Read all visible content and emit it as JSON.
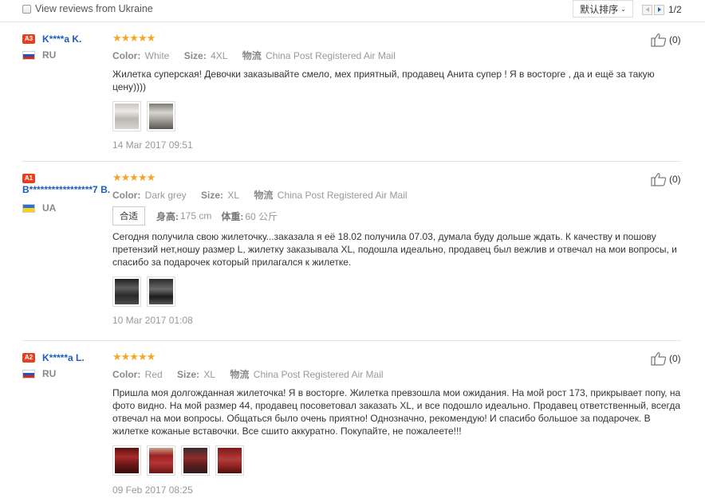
{
  "topbar": {
    "filter_label": "View reviews from Ukraine",
    "sort_label": "默认排序",
    "page_indicator": "1/2"
  },
  "reviews": [
    {
      "level": "A3",
      "name": "K****a K.",
      "country": "RU",
      "rating": 5,
      "stars_text": "★★★★★",
      "color_label": "Color:",
      "color_value": "White",
      "size_label": "Size:",
      "size_value": "4XL",
      "logistics_label": "物流",
      "logistics_value": "China Post Registered Air Mail",
      "text": "Жилетка суперская! Девочки заказывайте смело, мех приятный, продавец Анита супер ! Я в восторге , да и ещё за такую цену))))",
      "likes": "(0)",
      "date": "14 Mar 2017 09:51"
    },
    {
      "level": "A1",
      "name": "B*****************7 B.",
      "country": "UA",
      "rating": 5,
      "stars_text": "★★★★★",
      "color_label": "Color:",
      "color_value": "Dark grey",
      "size_label": "Size:",
      "size_value": "XL",
      "logistics_label": "物流",
      "logistics_value": "China Post Registered Air Mail",
      "fit_tag": "合适",
      "height_label": "身高:",
      "height_value": "175 cm",
      "weight_label": "体重:",
      "weight_value": "60 公斤",
      "text": "Сегодня получила свою жилеточку...заказала я её 18.02 получила 07.03, думала буду дольше ждать. К качеству и пошову претензий нет,ношу размер L, жилетку заказывала XL, подошла идеально, продавец был вежлив и отвечал на мои вопросы, и спасибо за подарочек который прилагался к жилетке.",
      "likes": "(0)",
      "date": "10 Mar 2017 01:08"
    },
    {
      "level": "A2",
      "name": "K*****a L.",
      "country": "RU",
      "rating": 5,
      "stars_text": "★★★★★",
      "color_label": "Color:",
      "color_value": "Red",
      "size_label": "Size:",
      "size_value": "XL",
      "logistics_label": "物流",
      "logistics_value": "China Post Registered Air Mail",
      "text": "Пришла моя долгожданная жилеточка! Я в восторге. Жилетка превзошла мои ожидания. На мой рост 173, прикрывает попу, на фото видно. На мой размер 44, продавец посоветовал заказать XL, и все подошло идеально. Продавец ответственный, всегда отвечал на мои вопросы. Общаться было очень приятно! Однозначно, рекомендую! И спасибо большое за подарочек. В жилетке кожаные вставочки. Все сшито аккуратно. Покупайте, не пожалеете!!!",
      "likes": "(0)",
      "date": "09 Feb 2017 08:25"
    }
  ],
  "colors": {
    "star": "#f5a623",
    "username": "#1d5db7",
    "level_badge": "#e64021"
  }
}
